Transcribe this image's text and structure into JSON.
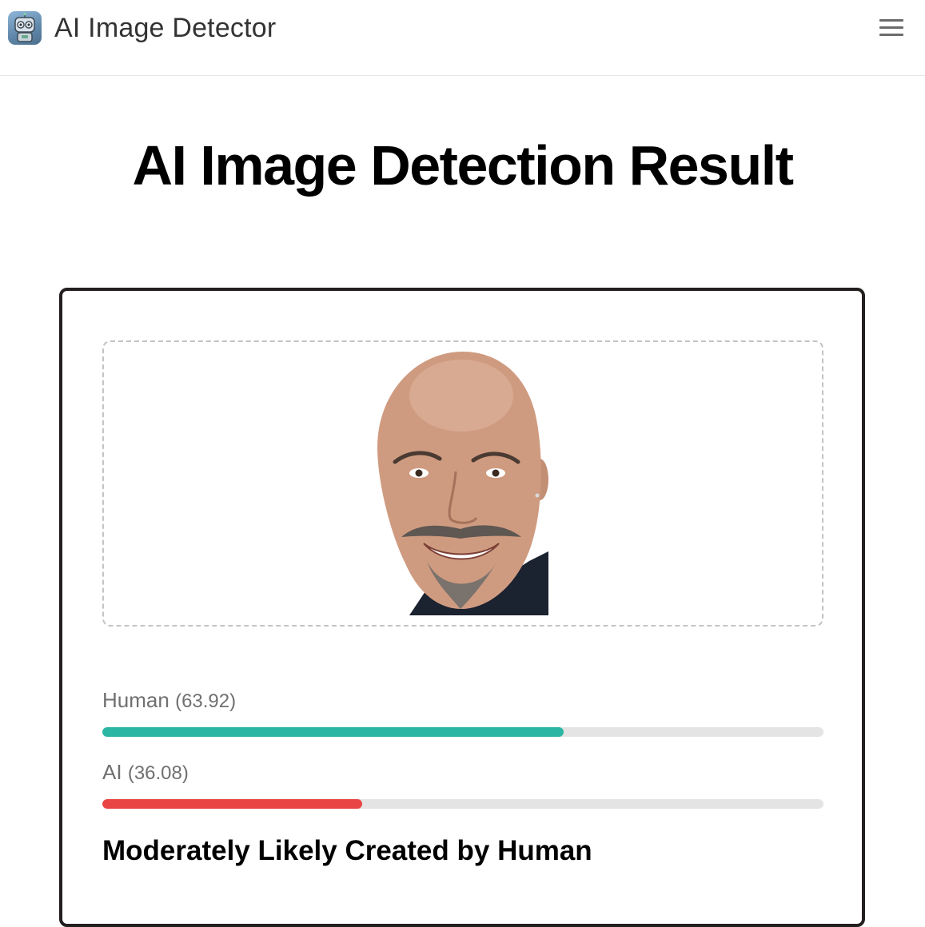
{
  "header": {
    "app_title": "AI Image Detector",
    "logo_icon": "robot-icon",
    "menu_icon": "hamburger-menu-icon"
  },
  "page": {
    "title": "AI Image Detection Result"
  },
  "result": {
    "image_icon": "uploaded-portrait-image",
    "scores": [
      {
        "label": "Human",
        "value": "63.92",
        "percent": 63.92,
        "color": "#2bb5a3"
      },
      {
        "label": "AI",
        "value": "36.08",
        "percent": 36.08,
        "color": "#ea4545"
      }
    ],
    "verdict": "Moderately Likely Created by Human"
  },
  "colors": {
    "human_bar": "#2bb5a3",
    "ai_bar": "#ea4545",
    "bar_track": "#e4e4e4",
    "card_border": "#231f1f"
  }
}
